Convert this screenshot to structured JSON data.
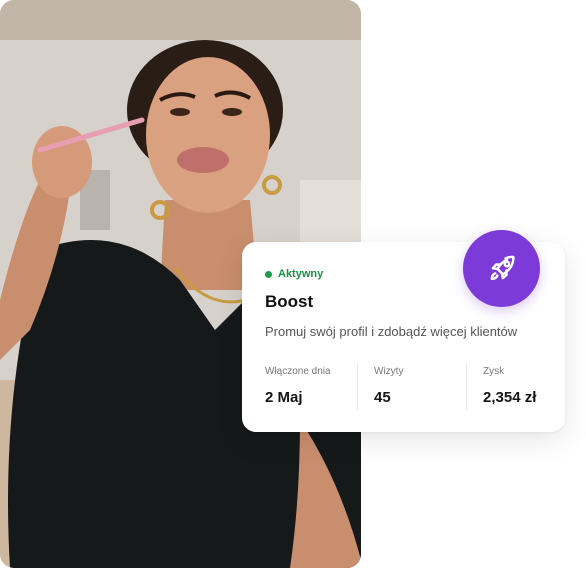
{
  "card": {
    "status_label": "Aktywny",
    "title": "Boost",
    "subtitle": "Promuj swój profil i zdobądź więcej klientów",
    "stats": [
      {
        "label": "Włączone dnia",
        "value": "2 Maj"
      },
      {
        "label": "Wizyty",
        "value": "45"
      },
      {
        "label": "Zysk",
        "value": "2,354 zł"
      }
    ]
  },
  "colors": {
    "status_green": "#1a9e4b",
    "badge_purple": "#7c3ad9"
  },
  "icons": {
    "badge_icon": "rocket-icon"
  }
}
